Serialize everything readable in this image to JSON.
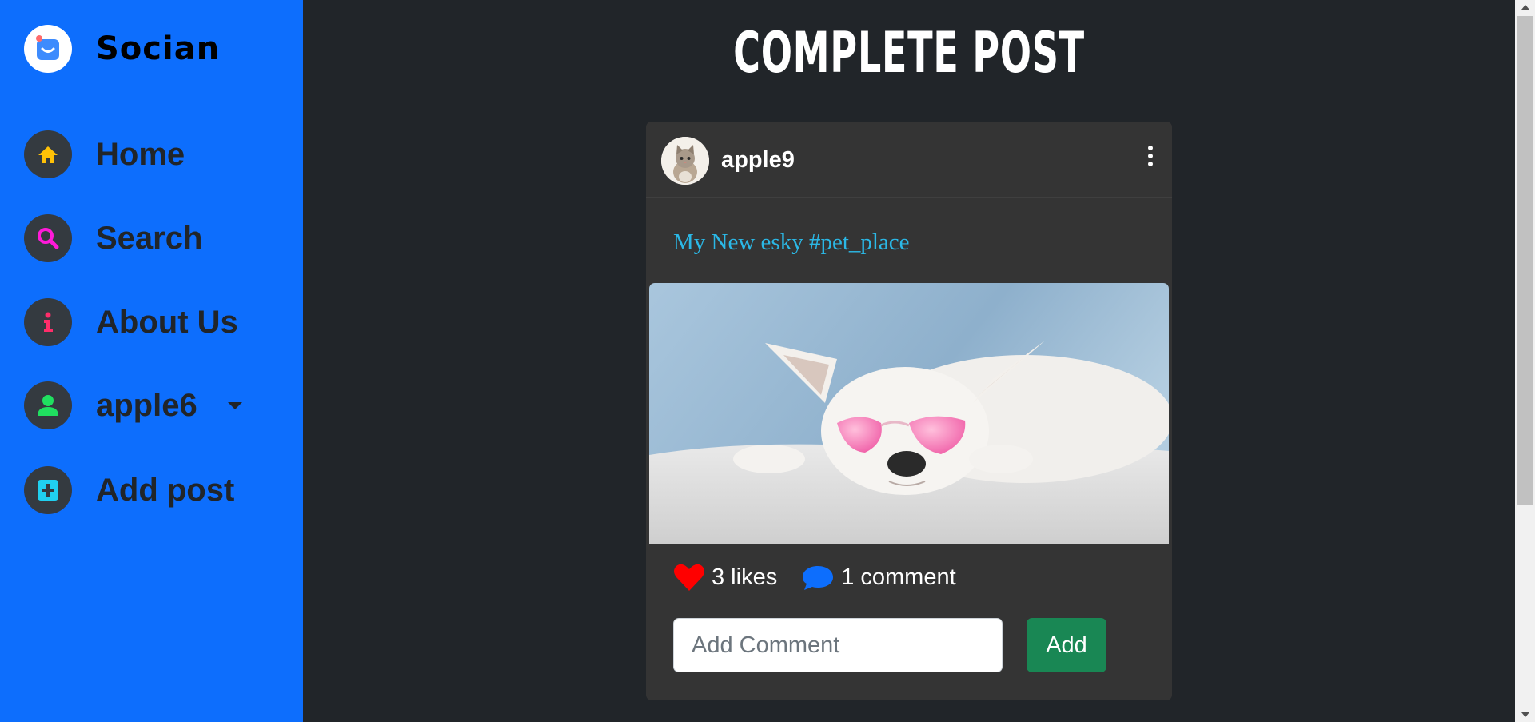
{
  "brand": {
    "name": "Socian"
  },
  "nav": {
    "items": [
      {
        "label": "Home",
        "icon": "home-icon",
        "color": "#ffc107"
      },
      {
        "label": "Search",
        "icon": "search-icon",
        "color": "#ff1ad9"
      },
      {
        "label": "About Us",
        "icon": "info-icon",
        "color": "#ff2d6a"
      },
      {
        "label": "apple6",
        "icon": "user-icon",
        "color": "#20e060"
      },
      {
        "label": "Add post",
        "icon": "plus-square-icon",
        "color": "#20d0f0"
      }
    ]
  },
  "main": {
    "title": "COMPLETE POST"
  },
  "post": {
    "username": "apple9",
    "caption": "My New esky #pet_place",
    "likes_text": "3 likes",
    "comments_text": "1 comment",
    "comment_placeholder": "Add Comment",
    "add_label": "Add"
  },
  "colors": {
    "sidebar": "#0d6efd",
    "background": "#212529",
    "card": "#343434",
    "caption": "#2bb8e6",
    "like": "#ff0000",
    "comment_icon": "#0d6efd",
    "add_button": "#198754"
  }
}
